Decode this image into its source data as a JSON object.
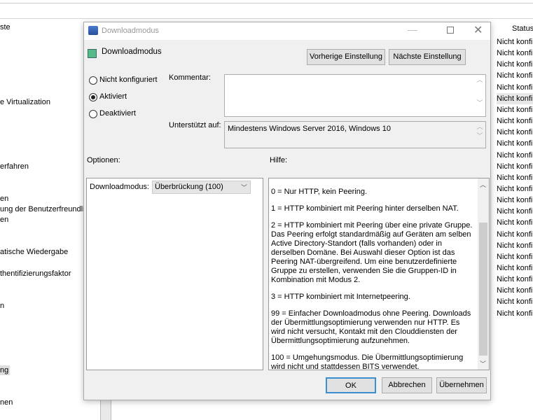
{
  "background": {
    "left_items": [
      "ste",
      "e Virtualization",
      "erfahren",
      "en",
      "ung der Benutzerfreundlich",
      "en",
      "atische Wiedergabe",
      "thentifizierungsfaktor",
      "n",
      "ng",
      "nen"
    ],
    "status_header": "Status",
    "status_rows": [
      "Nicht konfi",
      "Nicht konfi",
      "Nicht konfi",
      "Nicht konfi",
      "Nicht konfi",
      "Nicht konfi",
      "Nicht konfi",
      "Nicht konfi",
      "Nicht konfi",
      "Nicht konfi",
      "Nicht konfi",
      "Nicht konfi",
      "Nicht konfi",
      "Nicht konfi",
      "Nicht konfi",
      "Nicht konfi",
      "Nicht konfi",
      "Nicht konfi",
      "Nicht konfi",
      "Nicht konfi",
      "Nicht konfi",
      "Nicht konfi",
      "Nicht konfi",
      "Nicht konfi",
      "Nicht konfi"
    ]
  },
  "dialog": {
    "window_title": "Downloadmodus",
    "setting_title": "Downloadmodus",
    "prev_button": "Vorherige Einstellung",
    "next_button": "Nächste Einstellung",
    "radios": [
      {
        "label": "Nicht konfiguriert",
        "checked": false
      },
      {
        "label": "Aktiviert",
        "checked": true
      },
      {
        "label": "Deaktiviert",
        "checked": false
      }
    ],
    "comment_label": "Kommentar:",
    "comment_value": "",
    "supported_label": "Unterstützt auf:",
    "supported_value": "Mindestens Windows Server 2016, Windows 10",
    "options_label": "Optionen:",
    "help_label": "Hilfe:",
    "option_field_label": "Downloadmodus:",
    "option_field_value": "Überbrückung (100)",
    "help_paragraphs": [
      "0 = Nur HTTP, kein Peering.",
      "1 = HTTP kombiniert mit Peering hinter derselben NAT.",
      "2 = HTTP kombiniert mit Peering über eine private Gruppe. Das Peering erfolgt standardmäßig auf Geräten am selben Active Directory-Standort (falls vorhanden) oder in derselben Domäne. Bei Auswahl dieser Option ist das Peering NAT-übergreifend. Um eine benutzerdefinierte Gruppe zu erstellen, verwenden Sie die Gruppen-ID in Kombination mit Modus 2.",
      "3 = HTTP kombiniert mit Internetpeering.",
      "99 = Einfacher Downloadmodus ohne Peering. Downloads der Übermittlungsoptimierung verwenden nur HTTP. Es wird nicht versucht, Kontakt mit den Clouddiensten der Übermittlungsoptimierung aufzunehmen.",
      "100 = Umgehungsmodus. Die Übermittlungsoptimierung wird nicht und stattdessen BITS verwendet."
    ],
    "ok_button": "OK",
    "cancel_button": "Abbrechen",
    "apply_button": "Übernehmen"
  }
}
